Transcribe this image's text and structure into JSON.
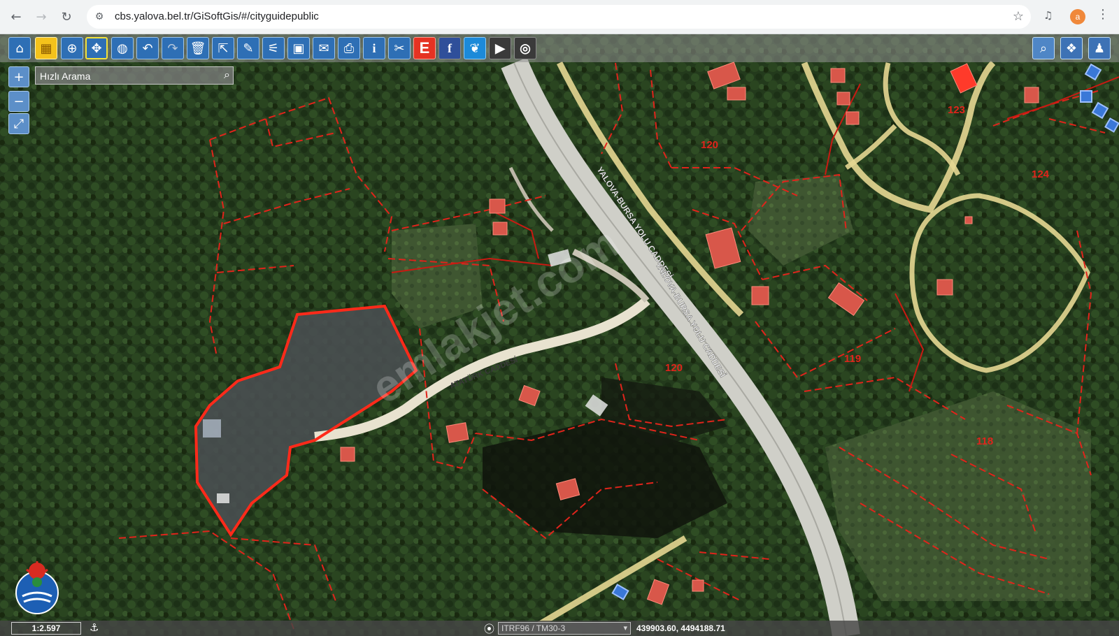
{
  "browser": {
    "back_icon": "back-arrow-icon",
    "forward_icon": "forward-arrow-icon",
    "reload_icon": "reload-icon",
    "url": "cbs.yalova.bel.tr/GiSoftGis/#/cityguidepublic",
    "profile_initial": "a"
  },
  "toolbar": {
    "left_tools": [
      "home-icon",
      "select-grid-icon",
      "zoom-search-icon",
      "pan-move-icon",
      "globe-icon",
      "undo-icon",
      "redo-icon",
      "delete-icon",
      "share-icon",
      "edit-pencil-icon",
      "measure-tool-icon",
      "frame-icon",
      "comment-icon",
      "print-icon",
      "info-icon",
      "scissors-icon",
      "e-service-icon",
      "facebook-icon",
      "twitter-icon",
      "youtube-icon",
      "instagram-icon"
    ],
    "e_label": "E",
    "facebook_label": "f",
    "info_label": "i",
    "right_tools": [
      "search-icon",
      "layers-icon",
      "user-icon"
    ]
  },
  "search": {
    "placeholder": "Hızlı Arama"
  },
  "zoom": {
    "in_label": "+",
    "out_label": "−",
    "fullscreen_icon": "fullscreen-icon"
  },
  "map": {
    "street_labels": [
      "YALOVA-BURSA YOLU CADDESİ",
      "YALOVA-BURSA YOLU CADDESİ",
      "ATATÜRK CADDESİ"
    ],
    "parcel_numbers": [
      "123",
      "120",
      "124",
      "119",
      "120",
      "118"
    ],
    "watermark": "emlakjet.com",
    "colors": {
      "parcel": "#e0241b",
      "road": "#e6d792",
      "highlight": "#ff2a1a"
    }
  },
  "status": {
    "scale": "1:2.597",
    "projection": "ITRF96 / TM30-3",
    "coordinates": "439903.60, 4494188.71"
  }
}
